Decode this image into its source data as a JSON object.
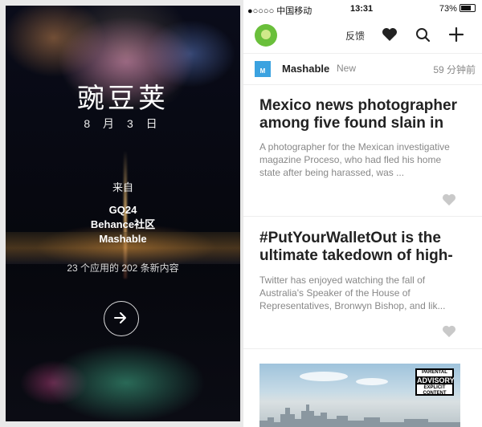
{
  "splash": {
    "logo": "豌豆荚",
    "date": "8 月 3 日",
    "from_label": "来自",
    "sources": [
      "GQ24",
      "Behance社区",
      "Mashable"
    ],
    "count_text": "23 个应用的 202 条新内容",
    "next_icon": "arrow-right-icon"
  },
  "statusbar": {
    "signal": "●○○○○ 中国移动",
    "time": "13:31",
    "battery": "73%"
  },
  "appbar": {
    "feedback_label": "反馈",
    "icons": [
      "avatar",
      "heart-icon",
      "search-icon",
      "plus-icon"
    ]
  },
  "source": {
    "name": "Mashable",
    "badge": "New",
    "time": "59 分钟前",
    "logo_letter": "M"
  },
  "articles": [
    {
      "title": "Mexico news photographer among five found slain in",
      "summary": "A photographer for the Mexican investigative magazine Proceso, who had fled his home state after being harassed, was ..."
    },
    {
      "title": "#PutYourWalletOut is the ultimate takedown of high-",
      "summary": "Twitter has enjoyed watching the fall of Australia's Speaker of the House of Representatives, Bronwyn Bishop, and lik..."
    }
  ],
  "image_card": {
    "advisory_top": "PARENTAL",
    "advisory_mid": "ADVISORY",
    "advisory_bottom": "EXPLICIT CONTENT"
  },
  "colors": {
    "accent": "#3ba2e0",
    "avatar": "#6abf3b"
  }
}
